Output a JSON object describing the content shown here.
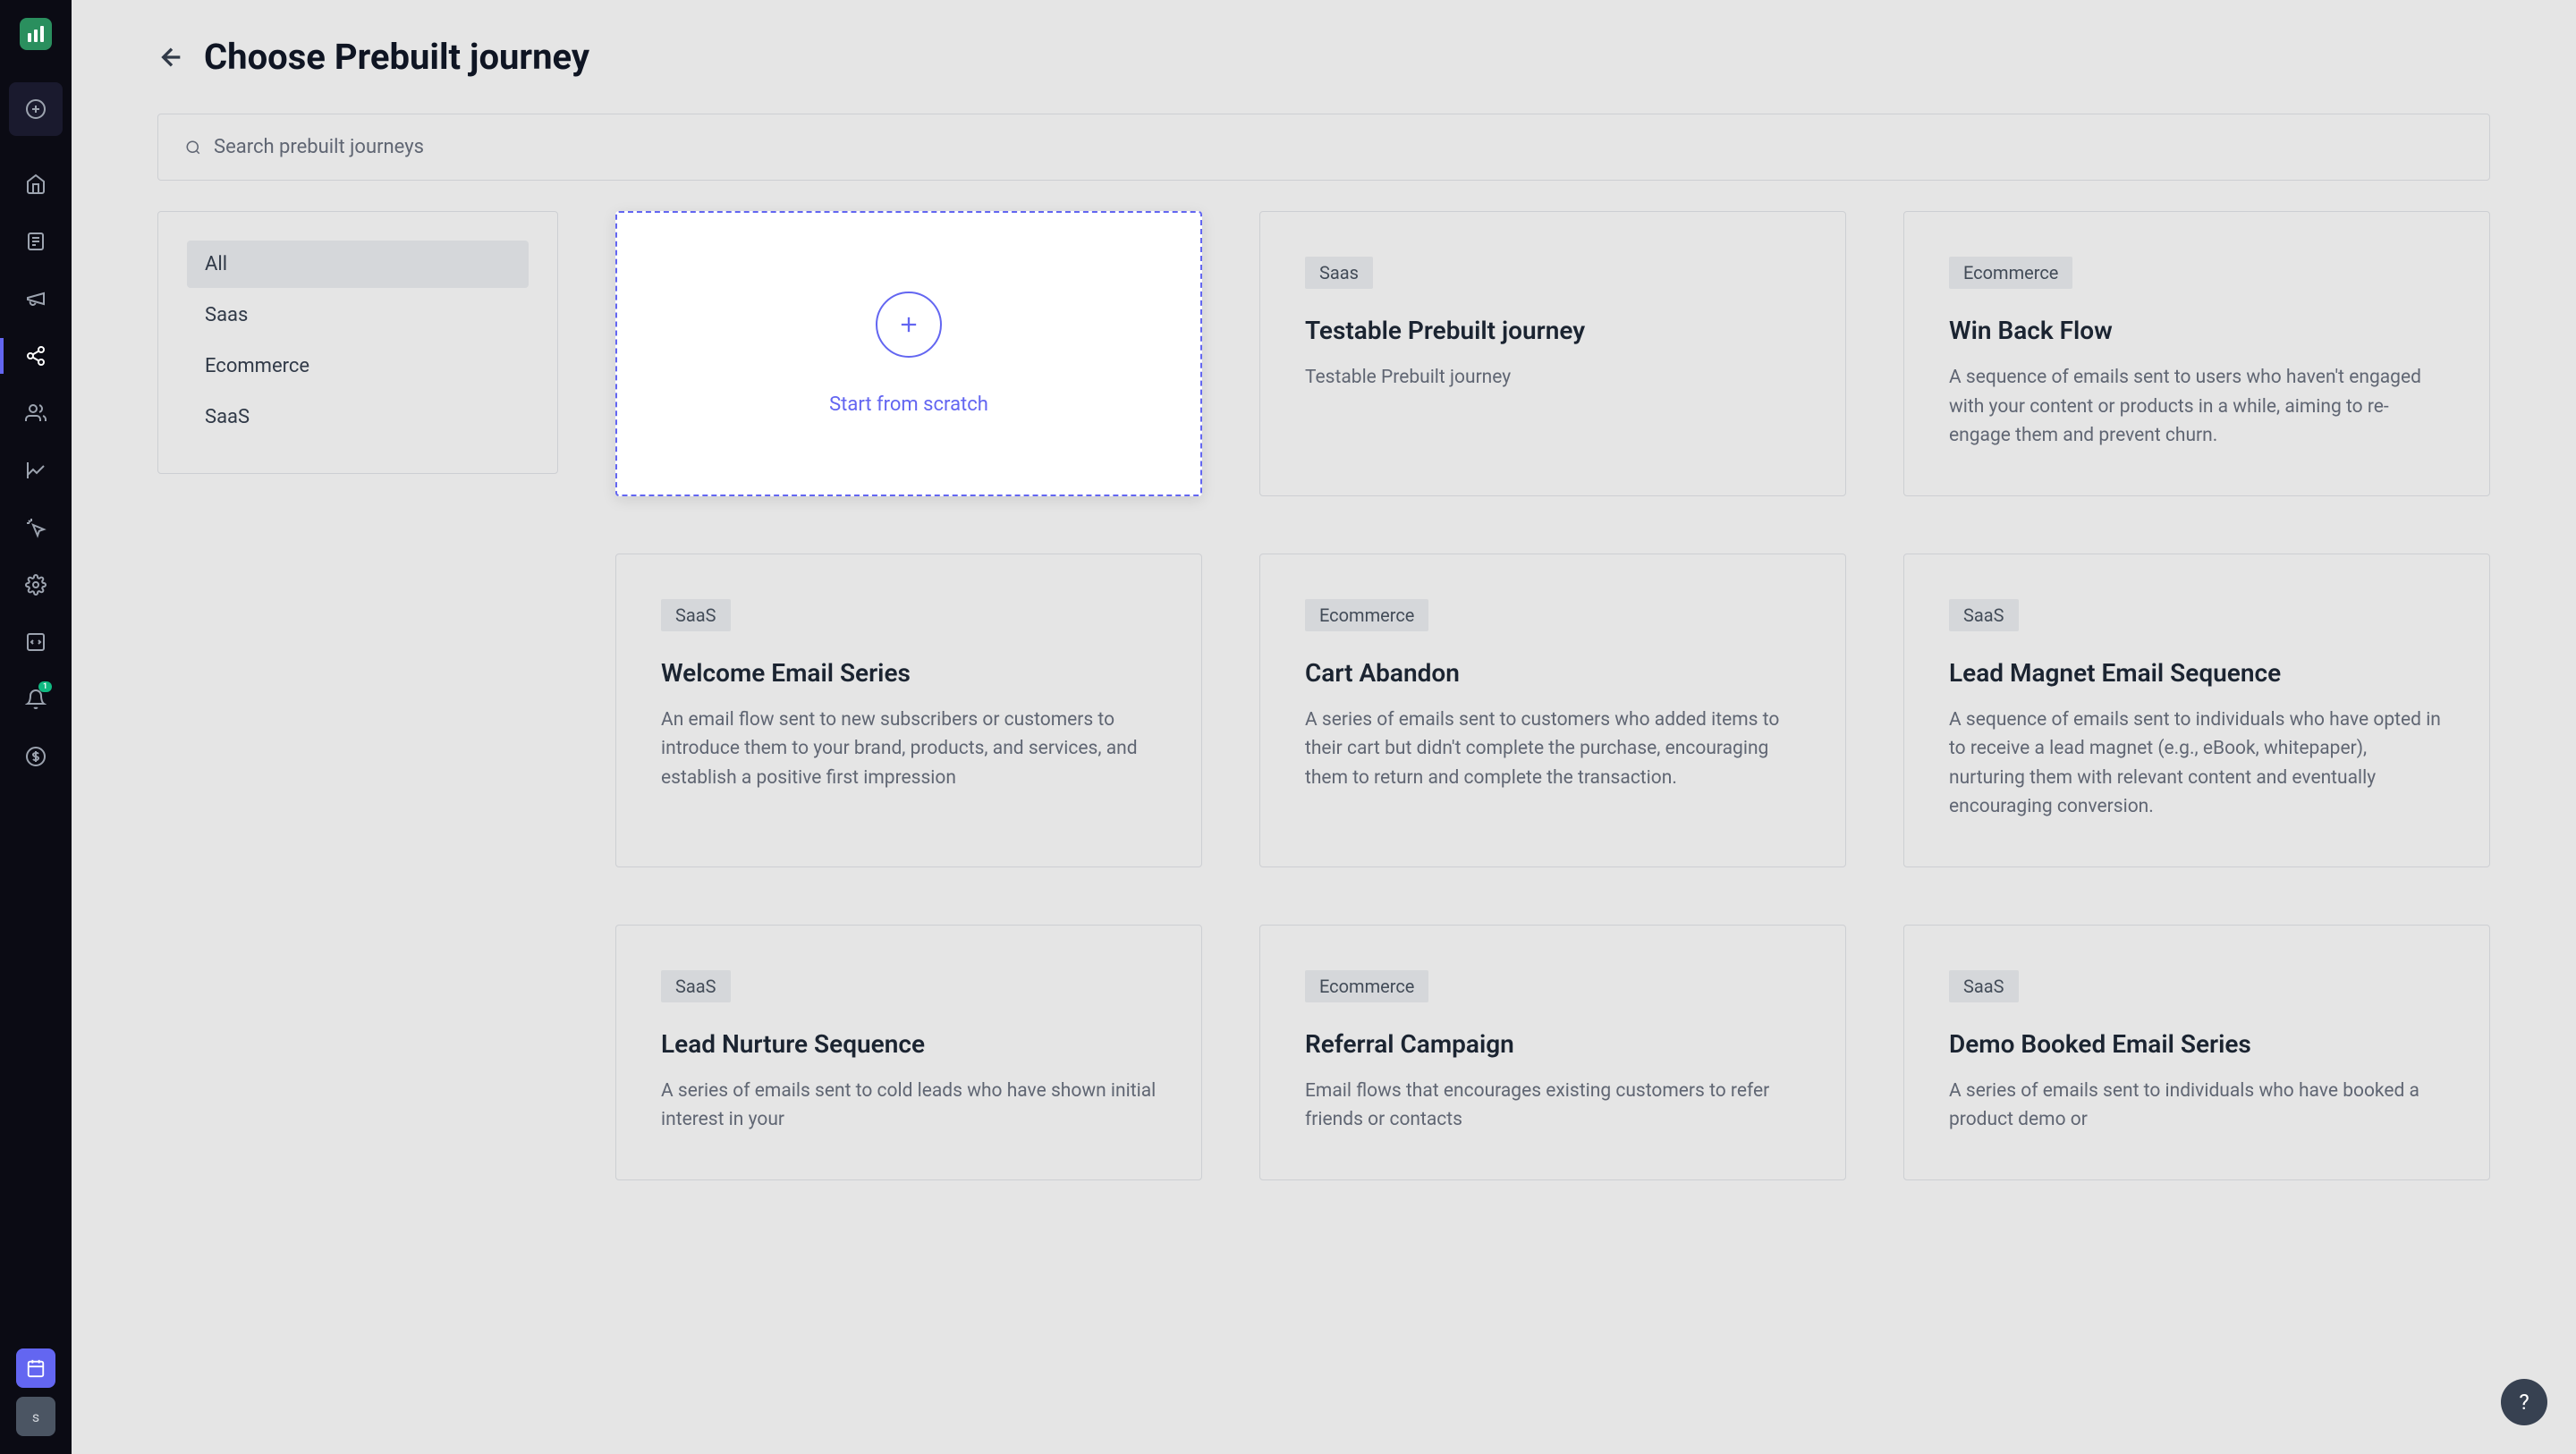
{
  "sidebar": {
    "notify_badge": "1",
    "avatar_letter": "s"
  },
  "header": {
    "title": "Choose Prebuilt journey"
  },
  "search": {
    "placeholder": "Search prebuilt journeys"
  },
  "filters": {
    "items": [
      {
        "label": "All",
        "active": true
      },
      {
        "label": "Saas",
        "active": false
      },
      {
        "label": "Ecommerce",
        "active": false
      },
      {
        "label": "SaaS",
        "active": false
      }
    ]
  },
  "scratch": {
    "label": "Start from scratch"
  },
  "cards": [
    {
      "tag": "Saas",
      "title": "Testable Prebuilt journey",
      "desc": "Testable Prebuilt journey"
    },
    {
      "tag": "Ecommerce",
      "title": "Win Back Flow",
      "desc": "A sequence of emails sent to users who haven't engaged with your content or products in a while, aiming to re-engage them and prevent churn."
    },
    {
      "tag": "SaaS",
      "title": "Welcome Email Series",
      "desc": "An email flow sent to new subscribers or customers to introduce them to your brand, products, and services, and establish a positive first impression"
    },
    {
      "tag": "Ecommerce",
      "title": "Cart Abandon",
      "desc": "A series of emails sent to customers who added items to their cart but didn't complete the purchase, encouraging them to return and complete the transaction."
    },
    {
      "tag": "SaaS",
      "title": "Lead Magnet Email Sequence",
      "desc": "A sequence of emails sent to individuals who have opted in to receive a lead magnet (e.g., eBook, whitepaper), nurturing them with relevant content and eventually encouraging conversion."
    },
    {
      "tag": "SaaS",
      "title": "Lead Nurture Sequence",
      "desc": "A series of emails sent to cold leads who have shown initial interest in your"
    },
    {
      "tag": "Ecommerce",
      "title": "Referral Campaign",
      "desc": "Email flows that encourages existing customers to refer friends or contacts"
    },
    {
      "tag": "SaaS",
      "title": "Demo Booked Email Series",
      "desc": "A series of emails sent to individuals who have booked a product demo or"
    }
  ],
  "help": {
    "label": "?"
  }
}
